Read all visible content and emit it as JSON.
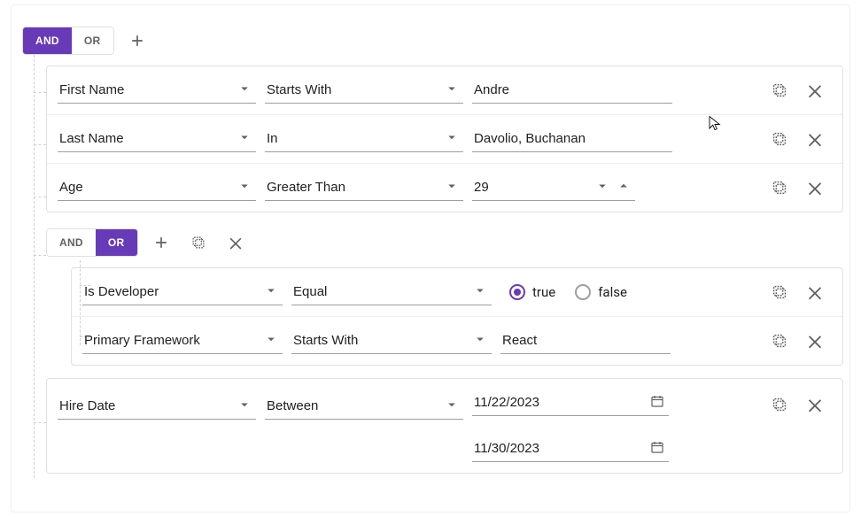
{
  "colors": {
    "accent": "#673ab7",
    "border": "#e0e0e0",
    "text_muted": "#616161"
  },
  "root": {
    "and_label": "AND",
    "or_label": "OR",
    "active": "and"
  },
  "rules": [
    {
      "field": "First Name",
      "op": "Starts With",
      "value": "Andre"
    },
    {
      "field": "Last Name",
      "op": "In",
      "value": "Davolio, Buchanan"
    },
    {
      "field": "Age",
      "op": "Greater Than",
      "value": "29"
    }
  ],
  "subgroup": {
    "and_label": "AND",
    "or_label": "OR",
    "active": "or",
    "rules": [
      {
        "field": "Is Developer",
        "op": "Equal",
        "radio_true": "true",
        "radio_false": "false",
        "selected": "true"
      },
      {
        "field": "Primary Framework",
        "op": "Starts With",
        "value": "React"
      }
    ]
  },
  "date_rule": {
    "field": "Hire Date",
    "op": "Between",
    "value1": "11/22/2023",
    "value2": "11/30/2023"
  }
}
